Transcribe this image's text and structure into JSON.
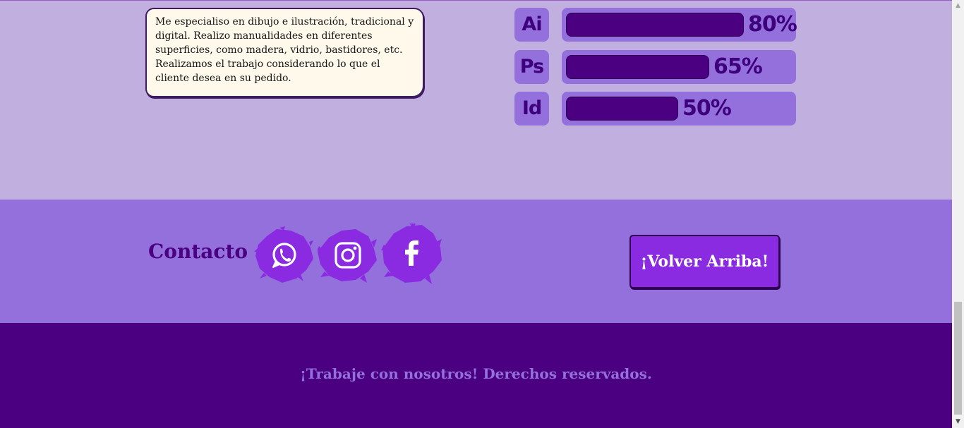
{
  "about": {
    "description": "Me especialiso en dibujo e ilustración, tradicional y digital. Realizo manualidades en diferentes superficies, como madera, vidrio, bastidores, etc. Realizamos el trabajo considerando lo que el cliente desea en su pedido."
  },
  "skills": [
    {
      "name": "Ai",
      "label": "80%",
      "level": 80,
      "fill_fraction": 0.76
    },
    {
      "name": "Ps",
      "label": "65%",
      "level": 65,
      "fill_fraction": 0.61
    },
    {
      "name": "Id",
      "label": "50%",
      "level": 50,
      "fill_fraction": 0.48
    }
  ],
  "contact": {
    "title": "Contacto",
    "socials": [
      {
        "name": "whatsapp",
        "icon": "whatsapp-icon"
      },
      {
        "name": "instagram",
        "icon": "instagram-icon"
      },
      {
        "name": "facebook",
        "icon": "facebook-icon"
      }
    ],
    "back_to_top_label": "¡Volver Arriba!"
  },
  "footer": {
    "text": "¡Trabaje con nosotros! Derechos reservados."
  },
  "colors": {
    "skills_background": "#c0afdf",
    "contact_background": "#9370db",
    "footer_background": "#4b0082",
    "accent": "#8a2be2",
    "dark_purple": "#3f007d"
  }
}
